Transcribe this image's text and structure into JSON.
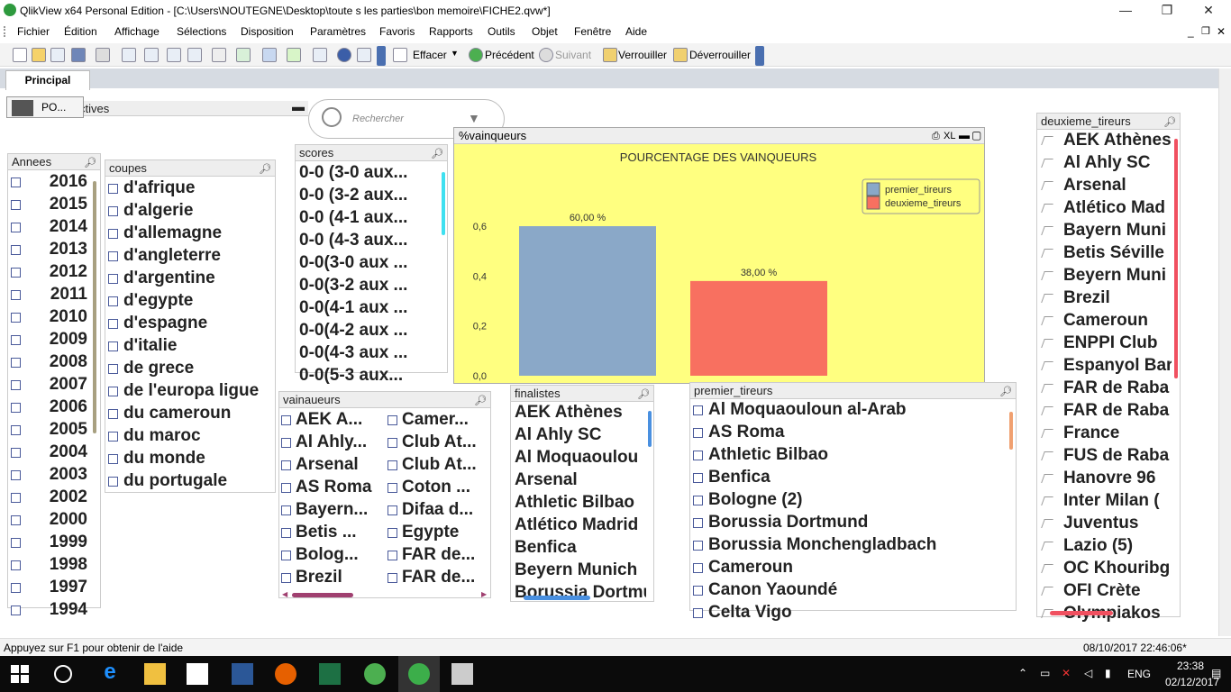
{
  "window": {
    "title": "QlikView x64 Personal Edition - [C:\\Users\\NOUTEGNE\\Desktop\\toute s les parties\\bon memoire\\FICHE2.qvw*]",
    "minimize": "—",
    "restore": "❐",
    "close": "✕"
  },
  "menu": {
    "items": [
      "Fichier",
      "Édition",
      "Affichage",
      "Sélections",
      "Disposition",
      "Paramètres",
      "Favoris",
      "Rapports",
      "Outils",
      "Objet",
      "Fenêtre",
      "Aide"
    ]
  },
  "toolbar": {
    "effacer": "Effacer",
    "precedent": "Précédent",
    "suivant": "Suivant",
    "verrouiller": "Verrouiller",
    "deverrouiller": "Déverrouiller"
  },
  "sheet": {
    "tab_principal": "Principal",
    "minimized_label": "PO...",
    "actives_title": "ctives",
    "search_placeholder": "Rechercher"
  },
  "annees": {
    "title": "Annees",
    "items": [
      "2016",
      "2015",
      "2014",
      "2013",
      "2012",
      "2011",
      "2010",
      "2009",
      "2008",
      "2007",
      "2006",
      "2005",
      "2004",
      "2003",
      "2002",
      "2000",
      "1999",
      "1998",
      "1997",
      "1994"
    ]
  },
  "coupes": {
    "title": "coupes",
    "items": [
      "d'afrique",
      "d'algerie",
      "d'allemagne",
      "d'angleterre",
      "d'argentine",
      "d'egypte",
      "d'espagne",
      "d'italie",
      "de grece",
      "de l'europa ligue",
      "du cameroun",
      "du maroc",
      "du monde",
      "du portugale"
    ]
  },
  "scores": {
    "title": "scores",
    "items": [
      "0-0 (3-0 aux...",
      "0-0 (3-2 aux...",
      "0-0 (4-1 aux...",
      "0-0 (4-3 aux...",
      "0-0(3-0 aux ...",
      "0-0(3-2 aux ...",
      "0-0(4-1 aux ...",
      "0-0(4-2 aux ...",
      "0-0(4-3 aux ...",
      "0-0(5-3 aux..."
    ]
  },
  "vainqueurs": {
    "title": "vainaueurs",
    "col1": [
      "AEK A...",
      "Al Ahly...",
      "Arsenal",
      "AS Roma",
      "Bayern...",
      "Betis ...",
      "Bolog...",
      "Brezil"
    ],
    "col2": [
      "Camer...",
      "Club At...",
      "Club At...",
      "Coton ...",
      "Difaa d...",
      "Egypte",
      "FAR de...",
      "FAR de..."
    ]
  },
  "finalistes": {
    "title": "finalistes",
    "items": [
      "AEK Athènes",
      "Al Ahly SC",
      "Al Moquaoulou",
      "Arsenal",
      "Athletic Bilbao",
      "Atlético Madrid",
      "Benfica",
      "Beyern Munich",
      "Borussia Dortmund"
    ]
  },
  "premier_tireurs": {
    "title": "premier_tireurs",
    "items": [
      "Al Moquaouloun  al-Arab",
      "AS Roma",
      "Athletic Bilbao",
      "Benfica",
      "Bologne (2)",
      "Borussia Dortmund",
      "Borussia Monchengladbach",
      "Cameroun",
      "Canon Yaoundé",
      "Celta Vigo"
    ]
  },
  "deuxieme_tireurs": {
    "title": "deuxieme_tireurs",
    "items": [
      "AEK Athènes",
      "Al Ahly SC",
      "Arsenal",
      "Atlético Mad",
      "Bayern Muni",
      "Betis Séville",
      "Beyern Muni",
      "Brezil",
      "Cameroun",
      "ENPPI Club",
      "Espanyol Bar",
      "FAR de Raba",
      "FAR de Raba",
      "France",
      "FUS de Raba",
      "Hanovre 96",
      "Inter Milan (",
      "Juventus",
      "Lazio (5)",
      "OC Khouribg",
      "OFI Crète",
      "Olympiakos"
    ]
  },
  "chart_header": {
    "title": "%vainqueurs",
    "xl": "XL"
  },
  "chart_data": {
    "type": "bar",
    "title": "POURCENTAGE DES VAINQUEURS",
    "series": [
      {
        "name": "premier_tireurs",
        "value": 0.6,
        "label": "60,00 %",
        "color": "#8aa8c8"
      },
      {
        "name": "deuxieme_tireurs",
        "value": 0.38,
        "label": "38,00 %",
        "color": "#f87060"
      }
    ],
    "yticks": [
      "0,0",
      "0,2",
      "0,4",
      "0,6"
    ],
    "ylim": [
      0,
      0.6
    ],
    "legend_position": "top-right",
    "background": "#ffff80"
  },
  "status": {
    "help": "Appuyez sur F1 pour obtenir de l'aide",
    "datetime": "08/10/2017 22:46:06*"
  },
  "taskbar": {
    "lang": "ENG",
    "time": "23:38",
    "date": "02/12/2017"
  }
}
